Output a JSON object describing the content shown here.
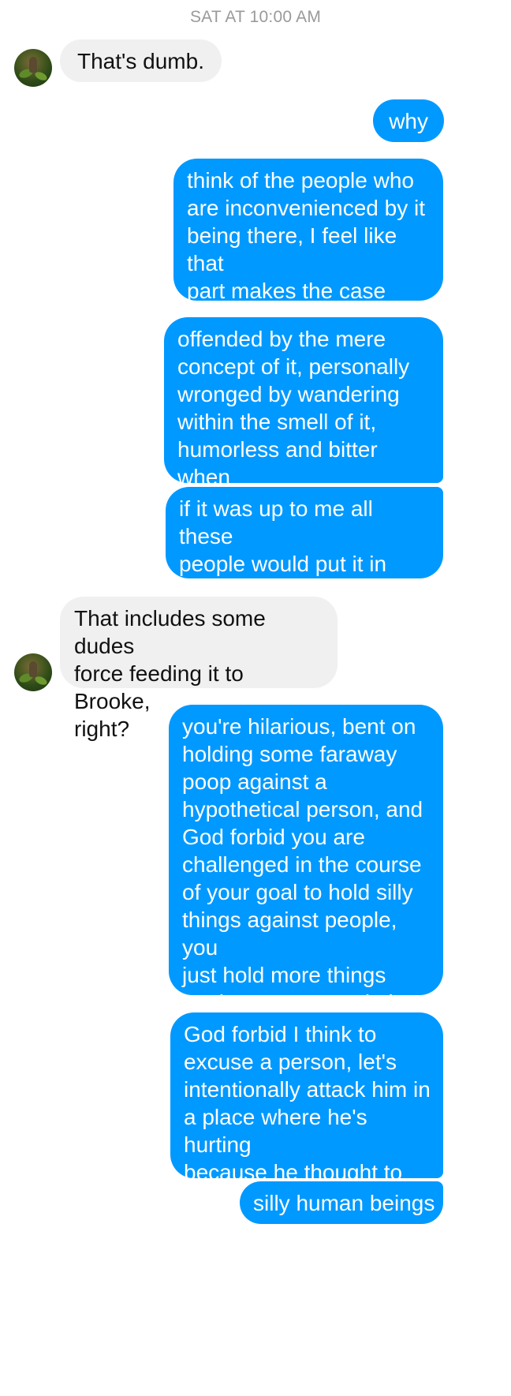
{
  "header": {
    "timestamp": "SAT AT 10:00 AM"
  },
  "colors": {
    "outgoing_bubble": "#0099ff",
    "incoming_bubble": "#f0f0f0",
    "timestamp_text": "#9a9a9a"
  },
  "messages": [
    {
      "direction": "incoming",
      "text": "That's dumb."
    },
    {
      "direction": "outgoing",
      "text": "why"
    },
    {
      "direction": "outgoing",
      "text": "think of the people who\nare inconvenienced by it\nbeing there, I feel like that\npart makes the case\nbetter than anything"
    },
    {
      "direction": "outgoing",
      "text": "offended by the mere\nconcept of it, personally\nwronged by wandering\nwithin the smell of it,\nhumorless and bitter when\nthey step in it"
    },
    {
      "direction": "outgoing",
      "text": "if it was up to me all these\npeople would put it in their\nmouths and chew it"
    },
    {
      "direction": "incoming",
      "text": "That includes some dudes\nforce feeding it to Brooke,\nright?"
    },
    {
      "direction": "outgoing",
      "text": "you're hilarious, bent on\nholding some faraway\npoop against a\nhypothetical person, and\nGod forbid you are\nchallenged in the course\nof your goal to hold silly\nthings against people, you\njust hold more things\nagainst more people in\nresponse"
    },
    {
      "direction": "outgoing",
      "text": "God forbid I think to\nexcuse a person, let's\nintentionally attack him in\na place where he's hurting\nbecause he thought to\nexcuse a person"
    },
    {
      "direction": "outgoing",
      "text": "silly human beings"
    }
  ]
}
